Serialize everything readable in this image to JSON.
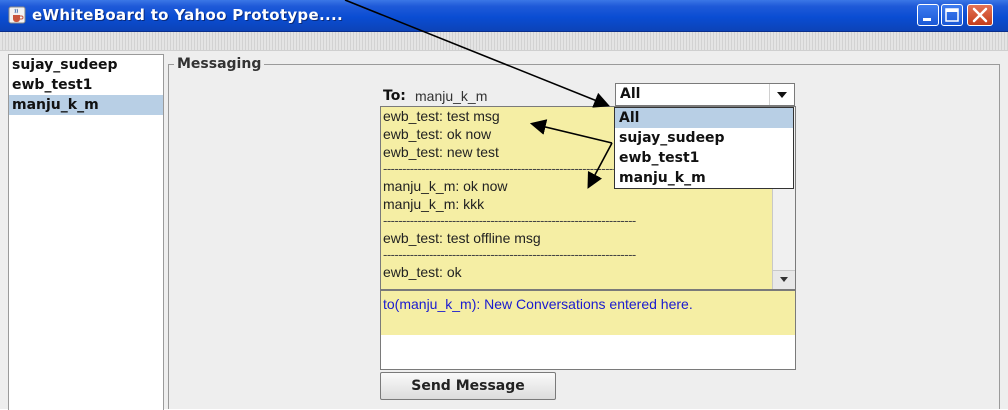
{
  "window": {
    "title": "eWhiteBoard to Yahoo Prototype....",
    "icons": {
      "app": "java-cup-icon",
      "minimize": "minimize-icon",
      "maximize": "maximize-icon",
      "close": "close-icon"
    }
  },
  "contacts": [
    {
      "label": "sujay_sudeep",
      "selected": false
    },
    {
      "label": "ewb_test1",
      "selected": false
    },
    {
      "label": "manju_k_m",
      "selected": true
    }
  ],
  "messaging": {
    "panel_title": "Messaging",
    "to_label": "To:",
    "to_value": "manju_k_m",
    "recipient_select": {
      "value": "All",
      "options": [
        "All",
        "sujay_sudeep",
        "ewb_test1",
        "manju_k_m"
      ],
      "highlighted": "All"
    },
    "history": [
      "ewb_test: test msg",
      "ewb_test:  ok now",
      "ewb_test:  new test",
      "------------------------------------------------------------------",
      "manju_k_m: ok now",
      "manju_k_m: kkk",
      "------------------------------------------------------------------",
      "ewb_test: test offline msg",
      "------------------------------------------------------------------",
      "ewb_test: ok"
    ],
    "compose_text": "to(manju_k_m): New Conversations entered here.",
    "send_label": "Send Message"
  },
  "colors": {
    "titlebar": "#0a4dd3",
    "message_background": "#f5eea4",
    "compose_text": "#1a1ad0",
    "selection": "#b8cfe5"
  }
}
